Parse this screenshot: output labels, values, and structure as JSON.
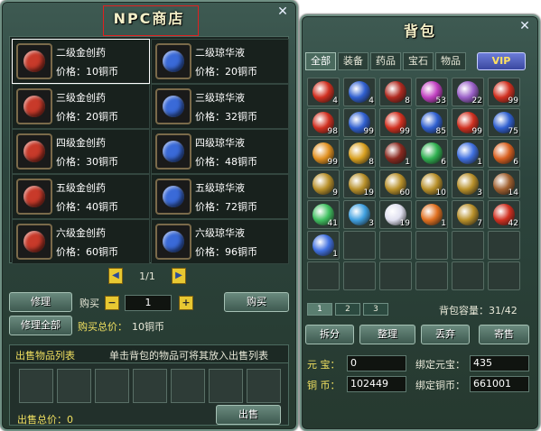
{
  "shop": {
    "title": "NPC商店",
    "items": [
      {
        "name": "二级金创药",
        "price": "价格：10铜币",
        "color": "#c83a2a"
      },
      {
        "name": "二级琼华液",
        "price": "价格：20铜币",
        "color": "#3a6ad8"
      },
      {
        "name": "三级金创药",
        "price": "价格：20铜币",
        "color": "#c83a2a"
      },
      {
        "name": "三级琼华液",
        "price": "价格：32铜币",
        "color": "#3a6ad8"
      },
      {
        "name": "四级金创药",
        "price": "价格：30铜币",
        "color": "#c83a2a"
      },
      {
        "name": "四级琼华液",
        "price": "价格：48铜币",
        "color": "#3a6ad8"
      },
      {
        "name": "五级金创药",
        "price": "价格：40铜币",
        "color": "#c83a2a"
      },
      {
        "name": "五级琼华液",
        "price": "价格：72铜币",
        "color": "#3a6ad8"
      },
      {
        "name": "六级金创药",
        "price": "价格：60铜币",
        "color": "#c83a2a"
      },
      {
        "name": "六级琼华液",
        "price": "价格：96铜币",
        "color": "#3a6ad8"
      }
    ],
    "page": "1/1",
    "repair": "修理",
    "repair_all": "修理全部",
    "buy_label": "购买",
    "quantity": "1",
    "buy_button": "购买",
    "total_label": "购买总价：",
    "total_value": "10铜币",
    "sell_list_title": "出售物品列表",
    "sell_hint": "单击背包的物品可将其放入出售列表",
    "sell_total": "出售总价：0",
    "sell_button": "出售"
  },
  "bag": {
    "title": "背包",
    "tabs": [
      "全部",
      "装备",
      "药品",
      "宝石",
      "物品"
    ],
    "vip": "VIP",
    "slots": [
      {
        "count": "4",
        "color": "#d03020",
        "icon": "red-potion-icon"
      },
      {
        "count": "4",
        "color": "#3060d0",
        "icon": "blue-potion-icon"
      },
      {
        "count": "8",
        "color": "#b02a20",
        "icon": "red-scroll-icon"
      },
      {
        "count": "53",
        "color": "#c040c0",
        "icon": "pink-potion-icon"
      },
      {
        "count": "22",
        "color": "#9a60c8",
        "icon": "purple-scroll-icon"
      },
      {
        "count": "99",
        "color": "#d03020",
        "icon": "red-potion-icon"
      },
      {
        "count": "98",
        "color": "#d03020",
        "icon": "red-potion-icon"
      },
      {
        "count": "99",
        "color": "#3060d0",
        "icon": "blue-potion-icon"
      },
      {
        "count": "99",
        "color": "#d03020",
        "icon": "red-potion-icon"
      },
      {
        "count": "85",
        "color": "#3060d0",
        "icon": "blue-potion-icon"
      },
      {
        "count": "99",
        "color": "#d03020",
        "icon": "red-potion-icon"
      },
      {
        "count": "75",
        "color": "#3060d0",
        "icon": "blue-potion-icon"
      },
      {
        "count": "99",
        "color": "#e09020",
        "icon": "fire-crystal-icon"
      },
      {
        "count": "8",
        "color": "#d8a020",
        "icon": "gold-claw-icon"
      },
      {
        "count": "1",
        "color": "#8a2a20",
        "icon": "red-orb-icon"
      },
      {
        "count": "6",
        "color": "#30b050",
        "icon": "green-gem-icon"
      },
      {
        "count": "1",
        "color": "#4070e0",
        "icon": "blue-gem-icon"
      },
      {
        "count": "6",
        "color": "#d86020",
        "icon": "fire-orb-icon"
      },
      {
        "count": "9",
        "color": "#b8902a",
        "icon": "gold-seal-icon"
      },
      {
        "count": "19",
        "color": "#b8902a",
        "icon": "gold-seal-icon"
      },
      {
        "count": "60",
        "color": "#b8902a",
        "icon": "gold-seal-icon"
      },
      {
        "count": "10",
        "color": "#b8902a",
        "icon": "gold-seal-icon"
      },
      {
        "count": "3",
        "color": "#b8902a",
        "icon": "gold-seal-icon"
      },
      {
        "count": "14",
        "color": "#a06030",
        "icon": "treasure-chest-icon"
      },
      {
        "count": "41",
        "color": "#40c060",
        "icon": "green-crystal-icon"
      },
      {
        "count": "3",
        "color": "#40a0e0",
        "icon": "cyan-crystal-icon"
      },
      {
        "count": "19",
        "color": "#e0e0f0",
        "icon": "white-crystal-icon"
      },
      {
        "count": "1",
        "color": "#e07020",
        "icon": "gift-box-icon"
      },
      {
        "count": "7",
        "color": "#b8902a",
        "icon": "gold-seal-icon"
      },
      {
        "count": "42",
        "color": "#d03020",
        "icon": "red-potion-icon"
      },
      {
        "count": "1",
        "color": "#4070e0",
        "icon": "blue-gem-icon"
      }
    ],
    "page_tabs": [
      "1",
      "2",
      "3"
    ],
    "capacity": "背包容量：31/42",
    "buttons": [
      "拆分",
      "整理",
      "丢弃",
      "寄售"
    ],
    "money": {
      "yuanbao_label": "元 宝：",
      "yuanbao": "0",
      "bound_yuanbao_label": "绑定元宝：",
      "bound_yuanbao": "435",
      "copper_label": "铜 币：",
      "copper": "102449",
      "bound_copper_label": "绑定铜币：",
      "bound_copper": "661001"
    }
  }
}
